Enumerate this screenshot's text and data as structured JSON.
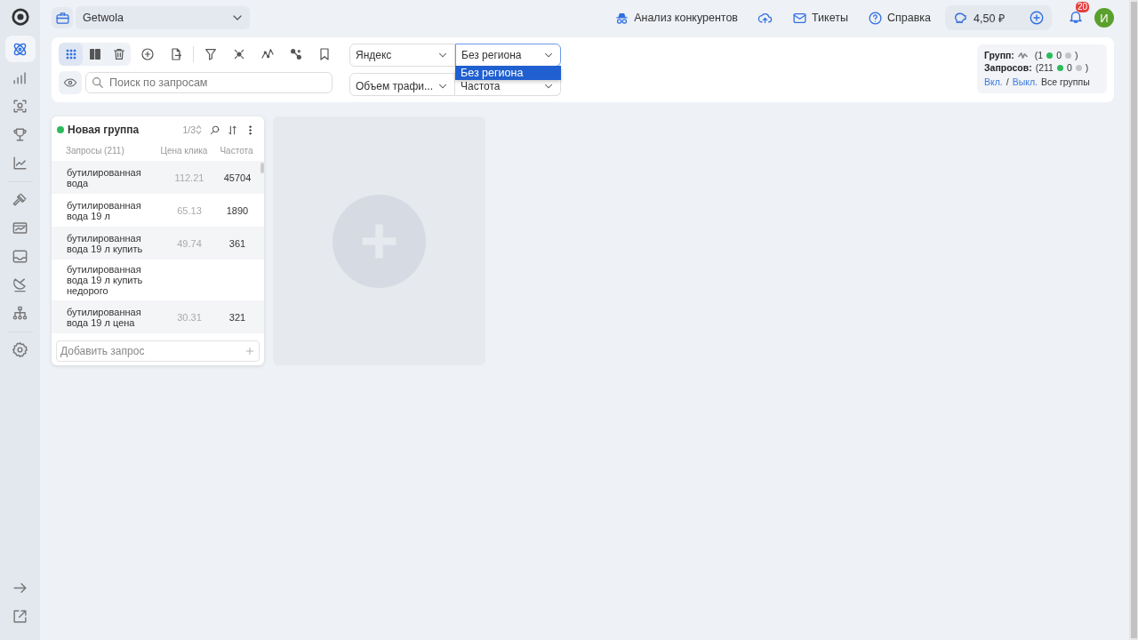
{
  "sidebar": {
    "items": [
      {
        "selected": true
      },
      {
        "selected": false
      },
      {
        "selected": false
      },
      {
        "selected": false
      },
      {
        "selected": false
      },
      {
        "selected": false
      },
      {
        "selected": false
      },
      {
        "selected": false
      },
      {
        "selected": false
      },
      {
        "selected": false
      },
      {
        "selected": false
      }
    ]
  },
  "top_bar": {
    "project": "Getwola",
    "links": [
      {
        "label": "Анализ конкурентов"
      },
      {
        "label": "Тикеты"
      },
      {
        "label": "Справка"
      }
    ],
    "balance": "4,50 ₽",
    "notifications": "20",
    "avatar": "И"
  },
  "toolbar": {
    "views": [
      {
        "selected": true
      },
      {
        "selected": false
      }
    ],
    "search": {
      "placeholder": "Поиск по запросам"
    },
    "selects": [
      {
        "value": "Яндекс",
        "open": false
      },
      {
        "value": "Без региона",
        "open": true,
        "options": [
          {
            "label": "Без региона",
            "selected": true
          }
        ]
      },
      {
        "value": "Объем трафи...",
        "open": false
      },
      {
        "value": "Частота",
        "open": false
      }
    ]
  },
  "stats": {
    "rows": [
      {
        "label": "Групп:",
        "on": "(1",
        "off": "0",
        "close": ")"
      },
      {
        "label": "Запросов:",
        "on": "(211",
        "off": "0",
        "close": ")"
      }
    ],
    "on_link": "Вкл.",
    "separator": "/",
    "off_link": "Выкл.",
    "all": "Все группы"
  },
  "group": {
    "title": "Новая группа",
    "active": true,
    "pager": "1/3",
    "columns": [
      "Запросы (211)",
      "Цена клика",
      "Частота"
    ],
    "rows": [
      {
        "query": "бутилированная вода",
        "price": "112.21",
        "frequency": "45704"
      },
      {
        "query": "бутилированная вода 19 л",
        "price": "65.13",
        "frequency": "1890"
      },
      {
        "query": "бутилированная вода 19 л купить",
        "price": "49.74",
        "frequency": "361"
      },
      {
        "query": "бутилированная вода 19 л купить недорого"
      },
      {
        "query": "бутилированная вода 19 л цена",
        "price": "30.31",
        "frequency": "321"
      }
    ],
    "add": {
      "placeholder": "Добавить запрос"
    }
  }
}
